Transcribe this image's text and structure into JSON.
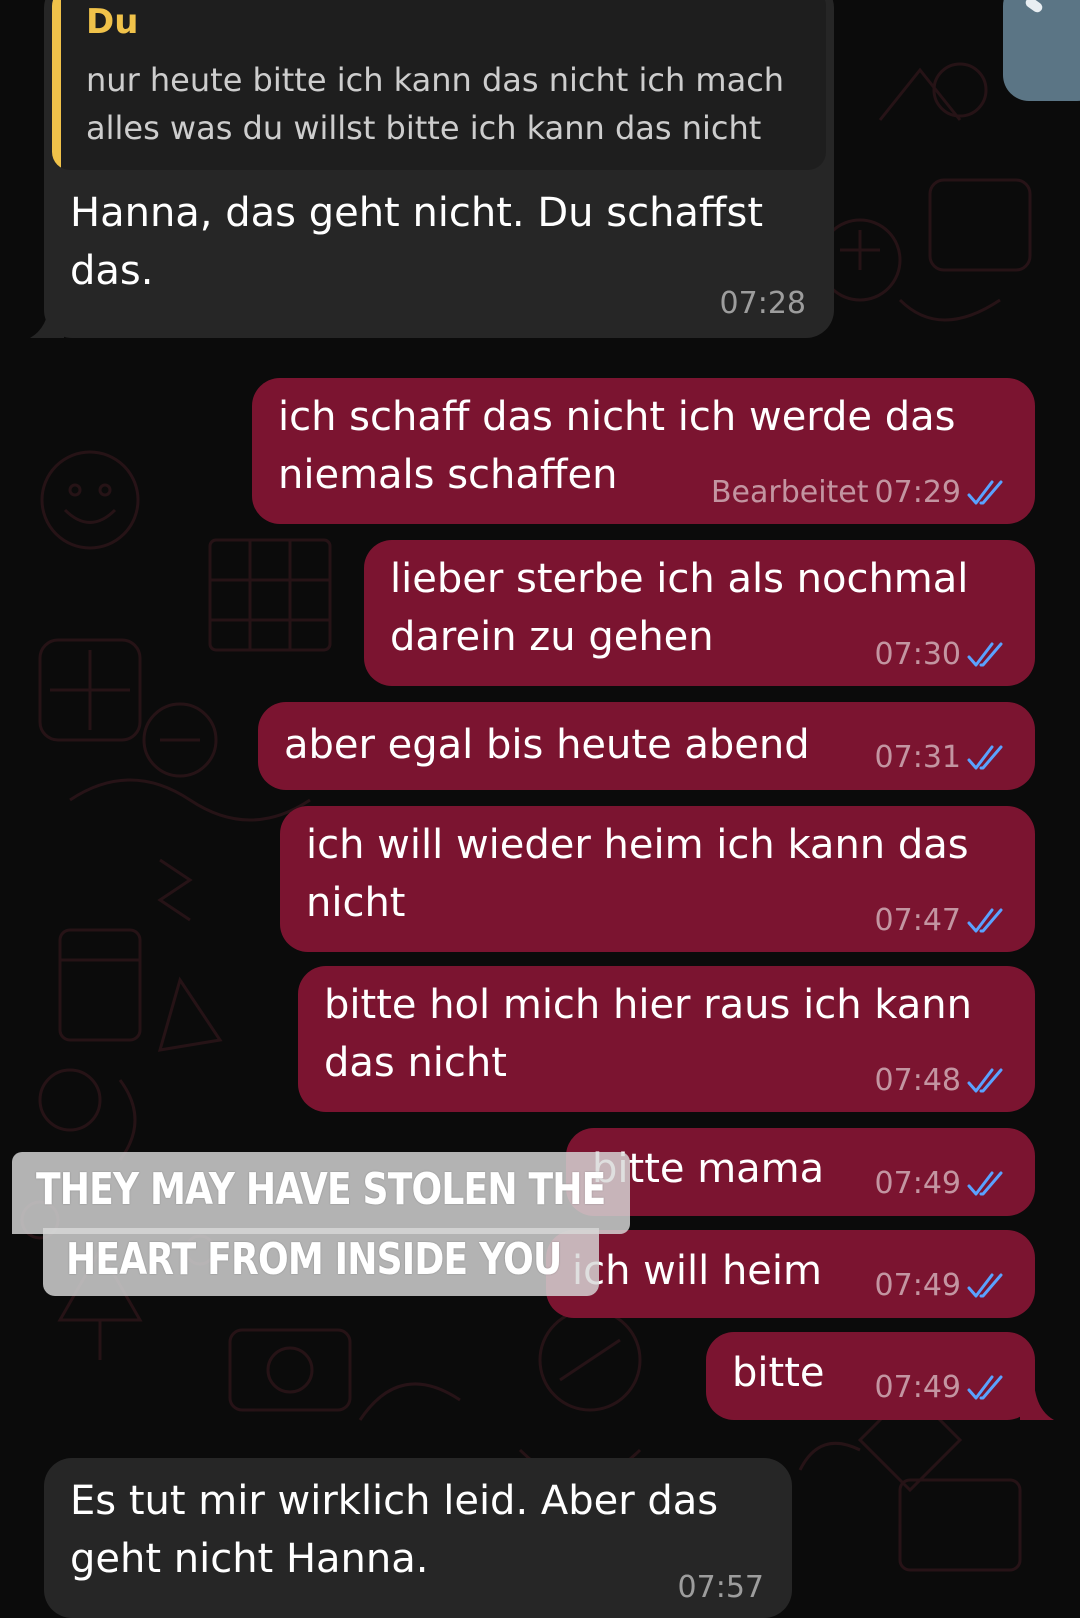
{
  "accent_colors": {
    "background": "#0b0b0b",
    "incoming_bubble": "#262626",
    "outgoing_bubble": "#7b1430",
    "quote_accent": "#f0c24a",
    "read_ticks": "#5aa2ff"
  },
  "messages": [
    {
      "direction": "incoming",
      "reply_quote": {
        "author": "Du",
        "lines": [
          "nur heute bitte ich kann das nicht ich mach",
          "alles was du willst bitte ich kann das nicht"
        ]
      },
      "lines": [
        "Hanna, das geht nicht. Du schaffst",
        "das."
      ],
      "time": "07:28"
    },
    {
      "direction": "outgoing",
      "lines": [
        "ich schaff das nicht ich werde das",
        "niemals schaffen"
      ],
      "edited_label": "Bearbeitet",
      "time": "07:29",
      "status_icon": "double-check-read-icon"
    },
    {
      "direction": "outgoing",
      "lines": [
        "lieber sterbe ich als nochmal",
        "darein zu gehen"
      ],
      "time": "07:30",
      "status_icon": "double-check-read-icon"
    },
    {
      "direction": "outgoing",
      "lines": [
        "aber egal bis heute abend"
      ],
      "time": "07:31",
      "status_icon": "double-check-read-icon"
    },
    {
      "direction": "outgoing",
      "lines": [
        "ich will wieder heim ich kann das",
        "nicht"
      ],
      "time": "07:47",
      "status_icon": "double-check-read-icon"
    },
    {
      "direction": "outgoing",
      "lines": [
        "bitte hol mich hier raus ich kann",
        "das nicht"
      ],
      "time": "07:48",
      "status_icon": "double-check-read-icon"
    },
    {
      "direction": "outgoing",
      "lines": [
        "bitte mama"
      ],
      "time": "07:49",
      "status_icon": "double-check-read-icon"
    },
    {
      "direction": "outgoing",
      "lines": [
        "ich will heim"
      ],
      "time": "07:49",
      "status_icon": "double-check-read-icon"
    },
    {
      "direction": "outgoing",
      "lines": [
        "bitte"
      ],
      "time": "07:49",
      "status_icon": "double-check-read-icon"
    },
    {
      "direction": "incoming",
      "lines": [
        "Es tut mir wirklich leid. Aber das",
        "geht nicht Hanna."
      ],
      "time": "07:57"
    }
  ],
  "overlay_caption": {
    "line1": "THEY MAY HAVE STOLEN THE",
    "line2": "HEART FROM INSIDE YOU"
  }
}
